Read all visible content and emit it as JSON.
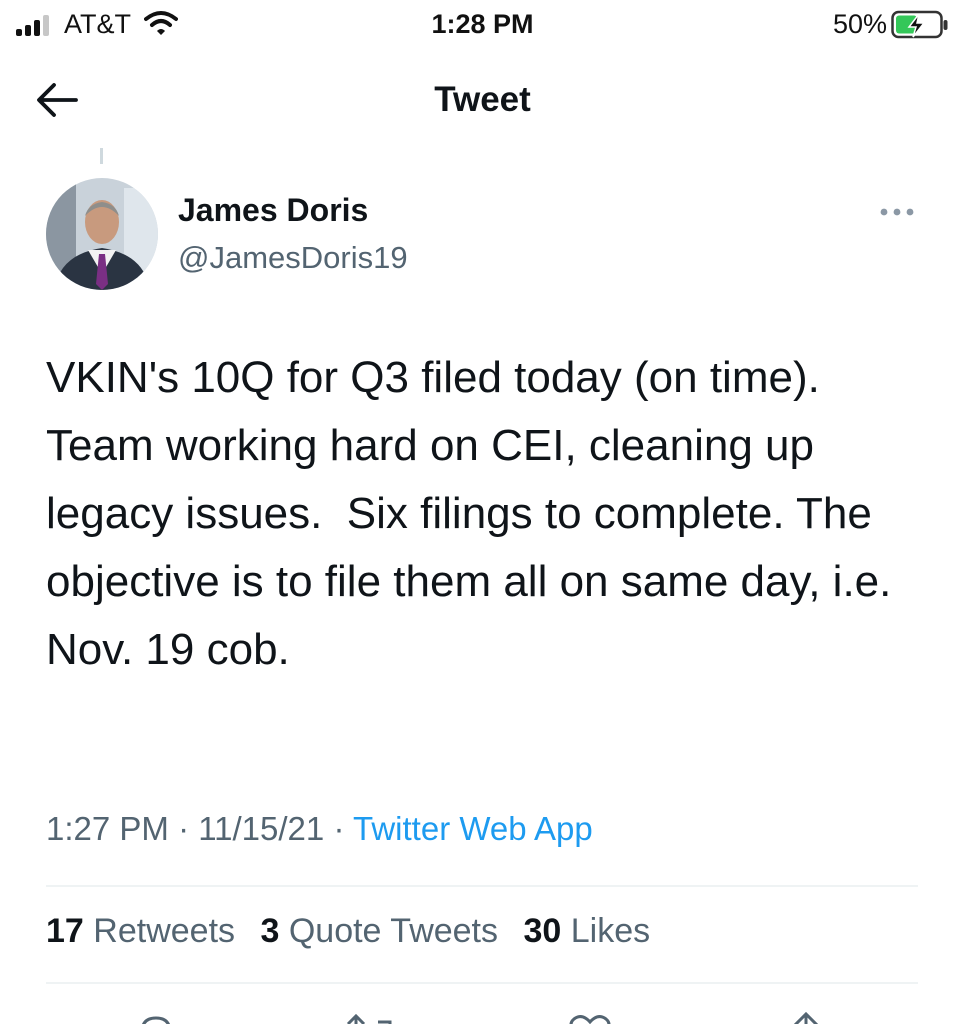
{
  "status_bar": {
    "carrier": "AT&T",
    "time": "1:28 PM",
    "battery_percent": "50%",
    "battery_level": 0.5,
    "charging": true,
    "icons": [
      "signal-icon",
      "wifi-icon",
      "battery-icon"
    ]
  },
  "nav": {
    "title": "Tweet",
    "back_icon": "arrow-left-icon"
  },
  "tweet": {
    "author": {
      "name": "James Doris",
      "handle": "@JamesDoris19"
    },
    "text": "VKIN's 10Q for Q3 filed today (on time). Team working hard on CEI, cleaning up legacy issues.  Six filings to complete. The objective is to file them all on same day, i.e. Nov. 19 cob.",
    "time": "1:27 PM",
    "separator": "·",
    "date": "11/15/21",
    "source": "Twitter Web App"
  },
  "stats": {
    "retweets_count": "17",
    "retweets_label": "Retweets",
    "quotes_count": "3",
    "quotes_label": "Quote Tweets",
    "likes_count": "30",
    "likes_label": "Likes"
  },
  "actions": [
    "reply-icon",
    "retweet-icon",
    "like-icon",
    "share-icon"
  ],
  "colors": {
    "link": "#1d9bf0",
    "text_primary": "#0f1419",
    "text_secondary": "#536471",
    "battery_charge": "#34c759"
  }
}
